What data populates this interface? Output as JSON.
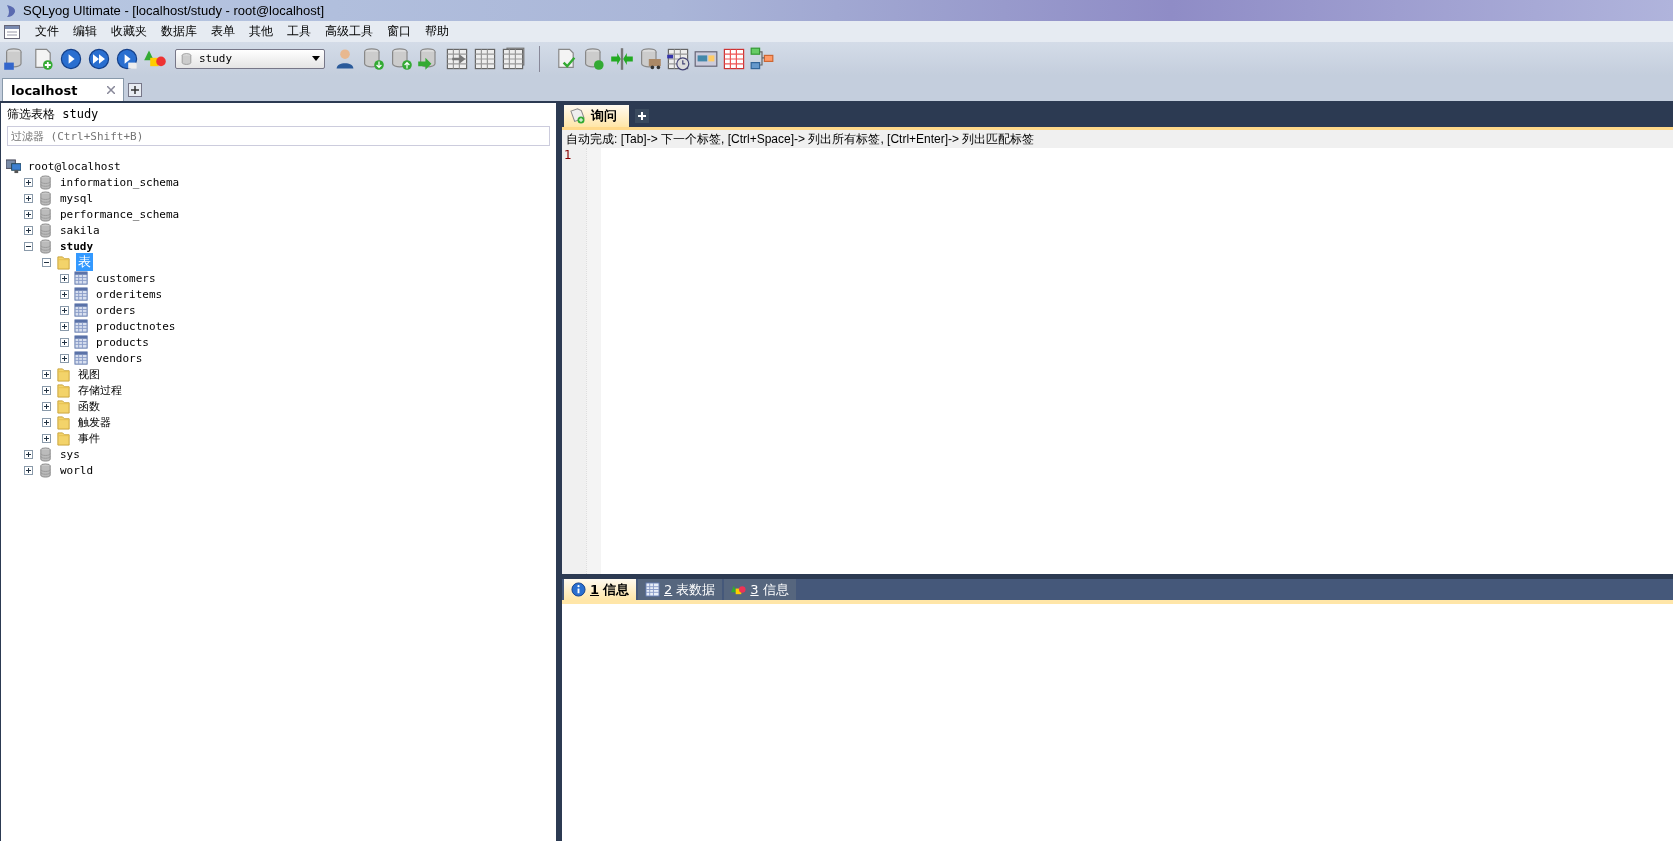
{
  "window": {
    "title": "SQLyog Ultimate - [localhost/study - root@localhost]"
  },
  "menu": [
    "文件",
    "编辑",
    "收藏夹",
    "数据库",
    "表单",
    "其他",
    "工具",
    "高级工具",
    "窗口",
    "帮助"
  ],
  "toolbar": {
    "database_select": "study"
  },
  "connection_tabs": [
    {
      "label": "localhost",
      "selected": true
    }
  ],
  "object_browser": {
    "filter_label": "筛选表格 study",
    "filter_placeholder": "过滤器 (Ctrl+Shift+B)",
    "tree": [
      {
        "kind": "server",
        "label": "root@localhost",
        "selected": false,
        "children": [
          {
            "kind": "database",
            "label": "information_schema",
            "expanded": false,
            "bold": false,
            "selected": false
          },
          {
            "kind": "database",
            "label": "mysql",
            "expanded": false,
            "bold": false,
            "selected": false
          },
          {
            "kind": "database",
            "label": "performance_schema",
            "expanded": false,
            "bold": false,
            "selected": false
          },
          {
            "kind": "database",
            "label": "sakila",
            "expanded": false,
            "bold": false,
            "selected": false
          },
          {
            "kind": "database",
            "label": "study",
            "expanded": true,
            "bold": true,
            "selected": false,
            "children": [
              {
                "kind": "folder",
                "label": "表",
                "expanded": true,
                "bold": false,
                "selected": true,
                "children": [
                  {
                    "kind": "table",
                    "label": "customers",
                    "expanded": false,
                    "bold": false,
                    "selected": false
                  },
                  {
                    "kind": "table",
                    "label": "orderitems",
                    "expanded": false,
                    "bold": false,
                    "selected": false
                  },
                  {
                    "kind": "table",
                    "label": "orders",
                    "expanded": false,
                    "bold": false,
                    "selected": false
                  },
                  {
                    "kind": "table",
                    "label": "productnotes",
                    "expanded": false,
                    "bold": false,
                    "selected": false
                  },
                  {
                    "kind": "table",
                    "label": "products",
                    "expanded": false,
                    "bold": false,
                    "selected": false
                  },
                  {
                    "kind": "table",
                    "label": "vendors",
                    "expanded": false,
                    "bold": false,
                    "selected": false
                  }
                ]
              },
              {
                "kind": "folder",
                "label": "视图",
                "expanded": false,
                "bold": false,
                "selected": false
              },
              {
                "kind": "folder",
                "label": "存储过程",
                "expanded": false,
                "bold": false,
                "selected": false
              },
              {
                "kind": "folder",
                "label": "函数",
                "expanded": false,
                "bold": false,
                "selected": false
              },
              {
                "kind": "folder",
                "label": "触发器",
                "expanded": false,
                "bold": false,
                "selected": false
              },
              {
                "kind": "folder",
                "label": "事件",
                "expanded": false,
                "bold": false,
                "selected": false
              }
            ]
          },
          {
            "kind": "database",
            "label": "sys",
            "expanded": false,
            "bold": false,
            "selected": false
          },
          {
            "kind": "database",
            "label": "world",
            "expanded": false,
            "bold": false,
            "selected": false
          }
        ]
      }
    ]
  },
  "query_tabs": [
    {
      "label": "询问",
      "selected": true
    }
  ],
  "autocomplete_hint": "自动完成: [Tab]-> 下一个标签, [Ctrl+Space]-> 列出所有标签, [Ctrl+Enter]-> 列出匹配标签",
  "editor": {
    "line_numbers": [
      "1"
    ]
  },
  "result_tabs": [
    {
      "kind": "info",
      "key": "1",
      "label": "信息",
      "selected": true
    },
    {
      "kind": "data",
      "key": "2",
      "label": "表数据",
      "selected": false
    },
    {
      "kind": "objects",
      "key": "3",
      "label": "信息",
      "selected": false
    }
  ]
}
